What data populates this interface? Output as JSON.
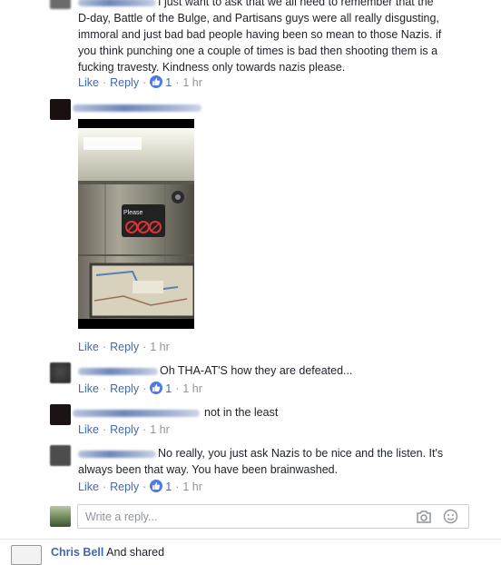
{
  "comments": [
    {
      "text_lines": [
        "I just want to ask that we all need to remember that the",
        "D-day, Battle of the Bulge, and Partisans guys were all really disgusting,",
        "immoral and just bad bad people having been so mean to those Nazis. if",
        "you think punching one a couple of times is bad then shooting them is a",
        "fucking travesty. Kindness only towards nazis please."
      ],
      "like": "Like",
      "reply": "Reply",
      "likes": "1",
      "time": "1 hr"
    },
    {
      "photo_sign": "Please",
      "like": "Like",
      "reply": "Reply",
      "time": "1 hr"
    },
    {
      "text": "Oh THA-AT'S how they are defeated...",
      "like": "Like",
      "reply": "Reply",
      "likes": "1",
      "time": "1 hr"
    },
    {
      "text": "not in the least",
      "like": "Like",
      "reply": "Reply",
      "time": "1 hr"
    },
    {
      "text_lines": [
        "No really, you just ask Nazis to be nice and the listen. It's",
        "always been that way. You have been brainwashed."
      ],
      "like": "Like",
      "reply": "Reply",
      "likes": "1",
      "time": "1 hr"
    }
  ],
  "reply_box": {
    "placeholder": "Write a reply..."
  },
  "bottom_post": {
    "name": "Chris Bell",
    "text": "And shared"
  },
  "icons": [
    "thumbs-up-icon",
    "camera-icon",
    "emoji-icon"
  ],
  "colors": {
    "link": "#4267b2",
    "meta": "#90949c",
    "like_badge": "#4d7be8",
    "text": "#1d2129"
  }
}
